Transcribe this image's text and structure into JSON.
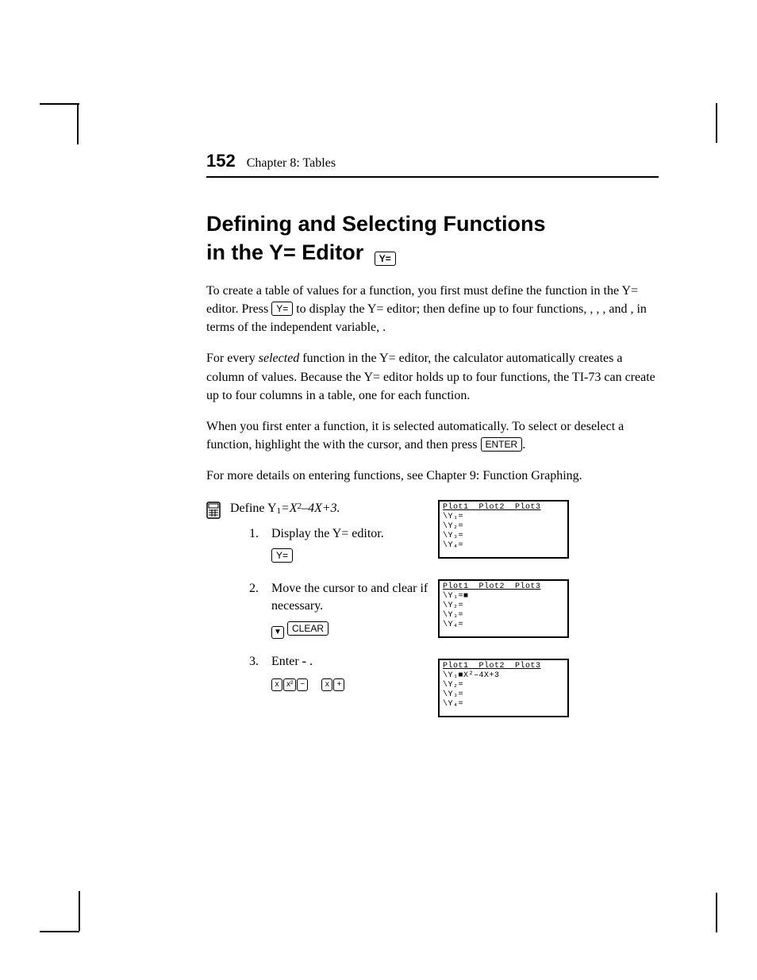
{
  "header": {
    "page_number": "152",
    "chapter": "Chapter 8: Tables"
  },
  "title_line1": "Defining and Selecting Functions",
  "title_line2_pre": "in the Y= Editor ",
  "title_key": "Y=",
  "para1_a": "To create a table of values for a function, you first must define the function in the Y= editor. Press ",
  "para1_key": "Y=",
  "para1_b": " to display the Y= editor; then define up to four functions,   ,   ,   , and   , in terms of the independent variable,  .",
  "para2_a": "For every ",
  "para2_em": "selected",
  "para2_b": " function in the Y= editor, the calculator automatically creates a column of    values. Because the Y= editor holds up to four functions, the TI‑73 can create up to four    columns in a table, one for each function.",
  "para3_a": "When you first enter a function, it is selected automatically. To select or deselect a function, highlight the    with the cursor, and then press ",
  "para3_key": "ENTER",
  "para3_b": ".",
  "para4": "For more details on entering functions, see Chapter 9: Function Graphing.",
  "example": {
    "intro_a": "Define Y",
    "intro_sub": "1",
    "intro_b": "=X",
    "intro_sup": "2",
    "intro_c": "–4X+3.",
    "step1": {
      "num": "1.",
      "text": "Display the Y= editor.",
      "key1": "Y="
    },
    "step2": {
      "num": "2.",
      "text_a": "Move the cursor to    and clear if necessary.",
      "key_arrow": "▼",
      "key_clear": "CLEAR"
    },
    "step3": {
      "num": "3.",
      "text_a": "Enter         ",
      "text_dash": "-",
      "text_b": "    .",
      "k1": "x",
      "k2": "x²",
      "k3": "−",
      "k4": "x",
      "k5": "+"
    }
  },
  "screens": {
    "plots": "Plot1  Plot2  Plot3",
    "s1_l1": "\\Y₁=",
    "s1_l2": "\\Y₂=",
    "s1_l3": "\\Y₃=",
    "s1_l4": "\\Y₄=",
    "s2_l1": "\\Y₁=■",
    "s2_l2": "\\Y₂=",
    "s2_l3": "\\Y₃=",
    "s2_l4": "\\Y₄=",
    "s3_l1": "\\Y₁■X²–4X+3",
    "s3_l2": "\\Y₂=",
    "s3_l3": "\\Y₃=",
    "s3_l4": "\\Y₄="
  }
}
